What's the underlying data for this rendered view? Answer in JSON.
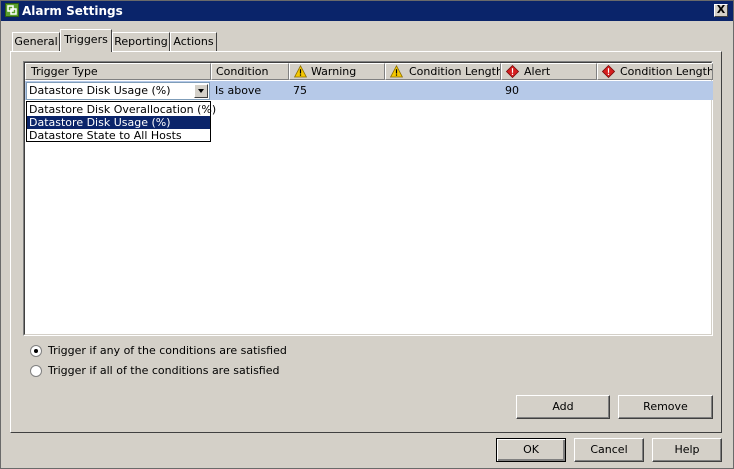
{
  "window": {
    "title": "Alarm Settings",
    "close_label": "X"
  },
  "tabs": [
    {
      "label": "General"
    },
    {
      "label": "Triggers"
    },
    {
      "label": "Reporting"
    },
    {
      "label": "Actions"
    }
  ],
  "grid": {
    "columns": [
      {
        "label": "Trigger Type",
        "icon": ""
      },
      {
        "label": "Condition",
        "icon": ""
      },
      {
        "label": "Warning",
        "icon": "warning-icon"
      },
      {
        "label": "Condition Length",
        "icon": "warning-icon"
      },
      {
        "label": "Alert",
        "icon": "alert-icon"
      },
      {
        "label": "Condition Length",
        "icon": "alert-icon"
      }
    ],
    "row": {
      "trigger_type": "Datastore Disk Usage (%)",
      "condition": "Is above",
      "warning": "75",
      "warning_length": "",
      "alert": "90",
      "alert_length": ""
    },
    "dropdown_options": [
      "Datastore Disk Overallocation (%)",
      "Datastore Disk Usage (%)",
      "Datastore State to All Hosts"
    ]
  },
  "radios": [
    {
      "label": "Trigger if any of the conditions are satisfied",
      "checked": true
    },
    {
      "label": "Trigger if all of the conditions are satisfied",
      "checked": false
    }
  ],
  "buttons": {
    "add": "Add",
    "remove": "Remove",
    "ok": "OK",
    "cancel": "Cancel",
    "help": "Help"
  },
  "colors": {
    "title_bar": "#0a246a",
    "selected_row": "#b6c9e8",
    "selection": "#0a246a",
    "warning": "#f5c800",
    "alert": "#d61f1f"
  }
}
